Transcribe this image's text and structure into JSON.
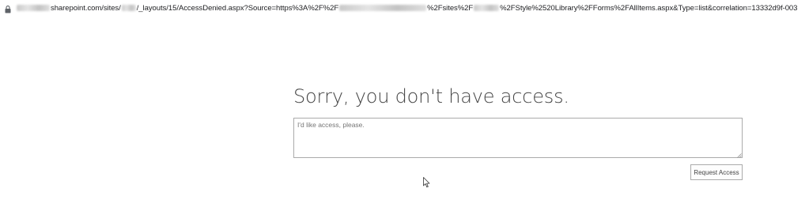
{
  "browser": {
    "url": {
      "domain_suffix": "sharepoint.com/sites/",
      "segment_1": "/_layouts/15/AccessDenied.aspx?Source=https%3A%2F%2F",
      "segment_2": "%2Fsites%2F",
      "segment_3": "%2FStyle%2520Library%2FForms%2FAllItems.aspx&Type=list&correlation=13332d9f-003"
    }
  },
  "page": {
    "heading": "Sorry, you don't have access.",
    "message_placeholder": "I'd like access, please.",
    "request_button_label": "Request Access"
  }
}
